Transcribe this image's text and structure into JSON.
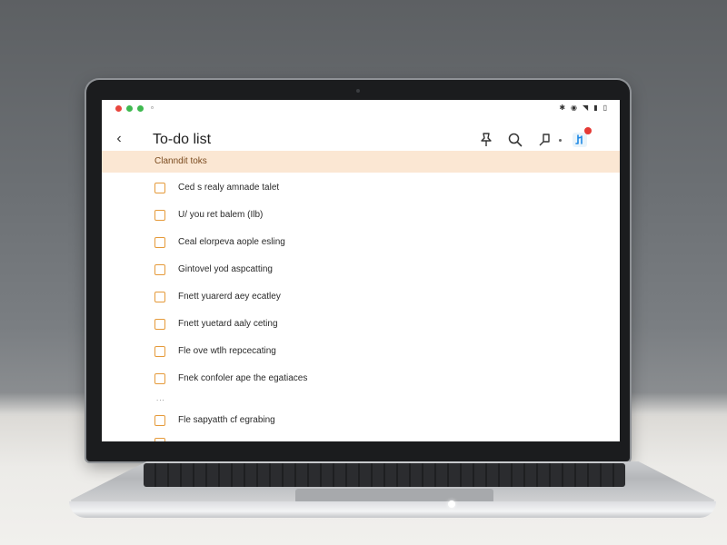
{
  "app": {
    "title": "To-do list"
  },
  "section": {
    "label": "Clanndit toks"
  },
  "tasks": [
    {
      "label": "Ced s realy amnade talet"
    },
    {
      "label": "U/ you ret balem (Ilb)"
    },
    {
      "label": "Ceal elorpeva aople esling"
    },
    {
      "label": "Gintovel yod aspcatting"
    },
    {
      "label": "Fnett yuarerd aey ecatley"
    },
    {
      "label": "Fnett yuetard aaly ceting"
    },
    {
      "label": "Fle ove wtlh repcecating"
    },
    {
      "label": "Fnek confoler ape the egatiaces"
    },
    {
      "label": "Fle sapyatth cf egrabing"
    }
  ],
  "ellipsis": "...",
  "header_icons": [
    "pin-icon",
    "search-icon",
    "notes-icon",
    "app-icon"
  ],
  "status_icons": [
    "bluetooth-icon",
    "location-icon",
    "wifi-icon",
    "signal-icon",
    "battery-icon"
  ],
  "colors": {
    "accent": "#e59a3a",
    "section_bg": "#fbe7d3",
    "badge": "#e53935"
  }
}
